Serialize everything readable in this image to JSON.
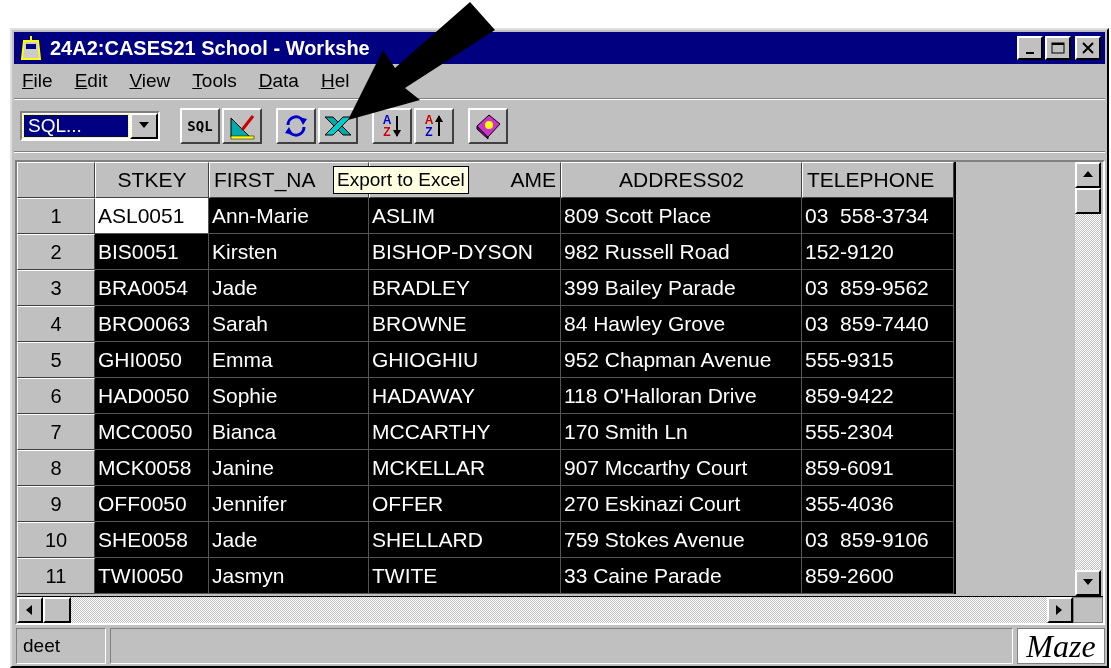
{
  "window": {
    "title": "24A2:CASES21 School - Workshe"
  },
  "menu": [
    {
      "label": "File"
    },
    {
      "label": "Edit"
    },
    {
      "label": "View"
    },
    {
      "label": "Tools"
    },
    {
      "label": "Data"
    },
    {
      "label": "Hel"
    }
  ],
  "toolbar": {
    "query_select": {
      "value": "SQL..."
    },
    "buttons": [
      {
        "kind": "sql",
        "label": "SQL"
      },
      {
        "kind": "design"
      },
      {
        "kind": "refresh"
      },
      {
        "kind": "excel"
      },
      {
        "kind": "sort_asc",
        "top": "A",
        "bottom": "Z"
      },
      {
        "kind": "sort_desc",
        "top": "A",
        "bottom": "Z"
      },
      {
        "kind": "help"
      }
    ]
  },
  "tooltip": "Export to Excel",
  "table": {
    "columns": [
      "STKEY",
      "FIRST_NA",
      "AME",
      "ADDRESS02",
      "TELEPHONE"
    ],
    "rows": [
      {
        "number": "1",
        "selected": true,
        "focused": true,
        "cells": [
          "ASL0051",
          "Ann-Marie",
          "ASLIM",
          "809 Scott Place",
          "03  558-3734"
        ]
      },
      {
        "number": "2",
        "selected": true,
        "focused": false,
        "cells": [
          "BIS0051",
          "Kirsten",
          "BISHOP-DYSON",
          "982 Russell Road",
          "152-9120"
        ]
      },
      {
        "number": "3",
        "selected": true,
        "focused": false,
        "cells": [
          "BRA0054",
          "Jade",
          "BRADLEY",
          "399 Bailey Parade",
          "03  859-9562"
        ]
      },
      {
        "number": "4",
        "selected": true,
        "focused": false,
        "cells": [
          "BRO0063",
          "Sarah",
          "BROWNE",
          "84 Hawley Grove",
          "03  859-7440"
        ]
      },
      {
        "number": "5",
        "selected": true,
        "focused": false,
        "cells": [
          "GHI0050",
          "Emma",
          "GHIOGHIU",
          "952 Chapman Avenue",
          "555-9315"
        ]
      },
      {
        "number": "6",
        "selected": true,
        "focused": false,
        "cells": [
          "HAD0050",
          "Sophie",
          "HADAWAY",
          "118 O'Halloran Drive",
          "859-9422"
        ]
      },
      {
        "number": "7",
        "selected": true,
        "focused": false,
        "cells": [
          "MCC0050",
          "Bianca",
          "MCCARTHY",
          "170 Smith Ln",
          "555-2304"
        ]
      },
      {
        "number": "8",
        "selected": true,
        "focused": false,
        "cells": [
          "MCK0058",
          "Janine",
          "MCKELLAR",
          "907 Mccarthy Court",
          "859-6091"
        ]
      },
      {
        "number": "9",
        "selected": true,
        "focused": false,
        "cells": [
          "OFF0050",
          "Jennifer",
          "OFFER",
          "270 Eskinazi Court",
          "355-4036"
        ]
      },
      {
        "number": "10",
        "selected": true,
        "focused": false,
        "cells": [
          "SHE0058",
          "Jade",
          "SHELLARD",
          "759 Stokes Avenue",
          "03  859-9106"
        ]
      },
      {
        "number": "11",
        "selected": true,
        "focused": false,
        "cells": [
          "TWI0050",
          "Jasmyn",
          "TWITE",
          "33 Caine Parade",
          "859-2600"
        ]
      }
    ]
  },
  "status_bar": {
    "text": "deet",
    "logo": "Maze"
  }
}
